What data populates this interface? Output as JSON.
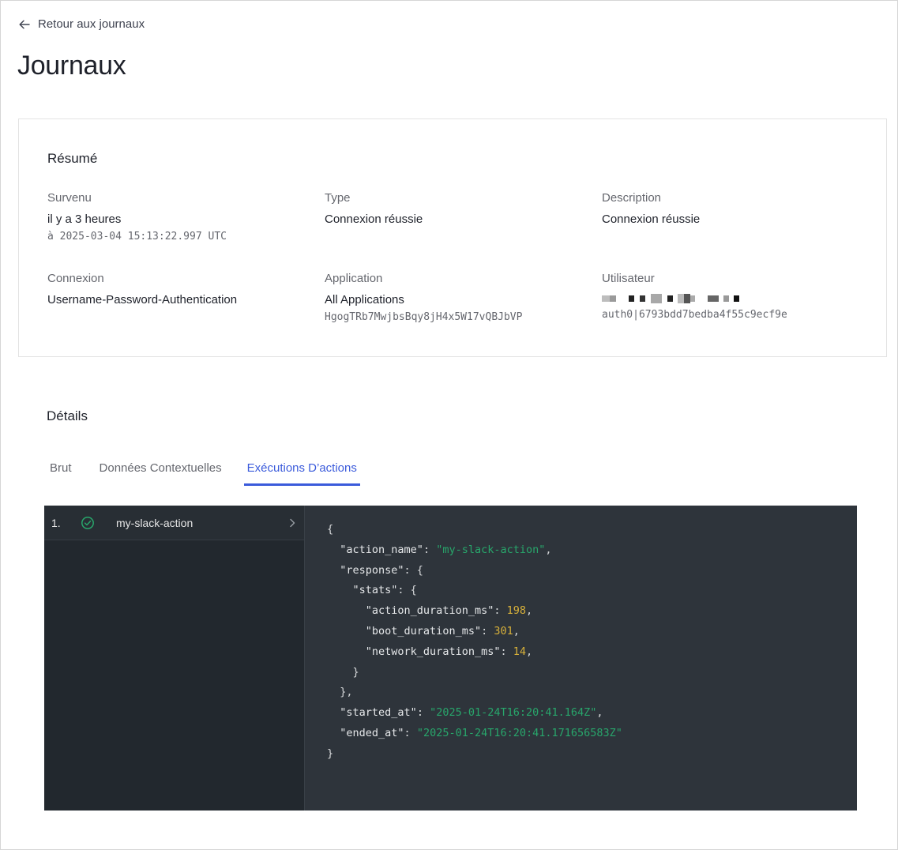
{
  "nav": {
    "back_label": "Retour aux journaux"
  },
  "page": {
    "title": "Journaux"
  },
  "summary": {
    "title": "Résumé",
    "occurred": {
      "label": "Survenu",
      "value": "il y a 3 heures",
      "sub": "à 2025-03-04 15:13:22.997 UTC"
    },
    "type": {
      "label": "Type",
      "value": "Connexion réussie"
    },
    "description": {
      "label": "Description",
      "value": "Connexion réussie"
    },
    "connection": {
      "label": "Connexion",
      "value": "Username-Password-Authentication"
    },
    "application": {
      "label": "Application",
      "value": "All Applications",
      "sub": "HgogTRb7MwjbsBqy8jH4x5W17vQBJbVP"
    },
    "user": {
      "label": "Utilisateur",
      "sub": "auth0|6793bdd7bedba4f55c9ecf9e"
    }
  },
  "details": {
    "title": "Détails",
    "tabs": [
      {
        "label": "Brut"
      },
      {
        "label": "Données Contextuelles"
      },
      {
        "label": "Exécutions D’actions"
      }
    ],
    "active_tab": "Exécutions D’actions",
    "executions": [
      {
        "index": "1.",
        "name": "my-slack-action",
        "status": "success"
      }
    ],
    "json": {
      "action_name_key": "\"action_name\"",
      "action_name_value": "\"my-slack-action\"",
      "response_key": "\"response\"",
      "stats_key": "\"stats\"",
      "action_duration_key": "\"action_duration_ms\"",
      "action_duration_value": "198",
      "boot_duration_key": "\"boot_duration_ms\"",
      "boot_duration_value": "301",
      "network_duration_key": "\"network_duration_ms\"",
      "network_duration_value": "14",
      "started_at_key": "\"started_at\"",
      "started_at_value": "\"2025-01-24T16:20:41.164Z\"",
      "ended_at_key": "\"ended_at\"",
      "ended_at_value": "\"2025-01-24T16:20:41.171656583Z\""
    }
  },
  "colors": {
    "accent": "#3b5bdb",
    "success": "#28a66b",
    "code_bg": "#2e343b",
    "number": "#d8b13a"
  },
  "icons": {
    "back": "arrow-left-icon",
    "status": "check-circle-icon",
    "expand": "chevron-right-icon"
  }
}
